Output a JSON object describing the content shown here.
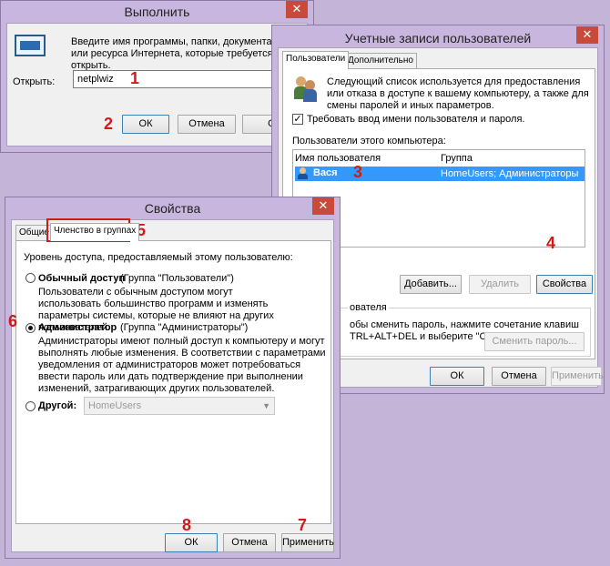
{
  "run": {
    "title": "Выполнить",
    "description": "Введите имя программы, папки, документа или ресурса Интернета, которые требуется открыть.",
    "open_label": "Открыть:",
    "input_value": "netplwiz",
    "ok": "ОК",
    "cancel": "Отмена",
    "browse": "Обз"
  },
  "accounts": {
    "title": "Учетные записи пользователей",
    "tabs": [
      "Пользователи",
      "Дополнительно"
    ],
    "description": "Следующий список используется для предоставления или отказа в доступе к вашему компьютеру, а также для смены паролей и иных параметров.",
    "require_login": "Требовать ввод имени пользователя и пароля.",
    "users_label": "Пользователи этого компьютера:",
    "columns": [
      "Имя пользователя",
      "Группа"
    ],
    "rows": [
      {
        "name": "Вася",
        "group": "HomeUsers; Администраторы"
      }
    ],
    "add": "Добавить...",
    "remove": "Удалить",
    "properties": "Свойства",
    "password_group": "ователя",
    "password_text_1": "обы сменить пароль, нажмите сочетание клавиш",
    "password_text_2": "TRL+ALT+DEL и выберите \"Сменить пароль\"",
    "change_password": "Сменить пароль...",
    "ok": "ОК",
    "cancel": "Отмена",
    "apply": "Применить"
  },
  "props": {
    "title": "Свойства",
    "tabs": [
      "Общие",
      "Членство в группах"
    ],
    "access_label": "Уровень доступа, предоставляемый этому пользователю:",
    "options": [
      {
        "label": "Обычный доступ",
        "group": "(Группа \"Пользователи\")",
        "desc": "Пользователи с обычным доступом могут использовать большинство программ и изменять параметры системы, которые не влияют на других пользователей."
      },
      {
        "label": "Администратор",
        "group": "(Группа \"Администраторы\")",
        "desc": "Администраторы имеют полный доступ к компьютеру и могут выполнять любые изменения. В соответствии с параметрами уведомления от администраторов может потребоваться ввести пароль или дать подтверждение при выполнении изменений, затрагивающих других пользователей."
      },
      {
        "label": "Другой:",
        "group": "",
        "desc": ""
      }
    ],
    "other_value": "HomeUsers",
    "ok": "ОК",
    "cancel": "Отмена",
    "apply": "Применить"
  },
  "steps": [
    "1",
    "2",
    "3",
    "4",
    "5",
    "6",
    "7",
    "8"
  ],
  "colors": {
    "accent": "#3399ff",
    "step": "#d01b1b",
    "frame": "#c9b6de"
  },
  "icons": [
    "run-app-icon",
    "users-icon",
    "user-icon",
    "close-icon",
    "chevron-down-icon"
  ]
}
